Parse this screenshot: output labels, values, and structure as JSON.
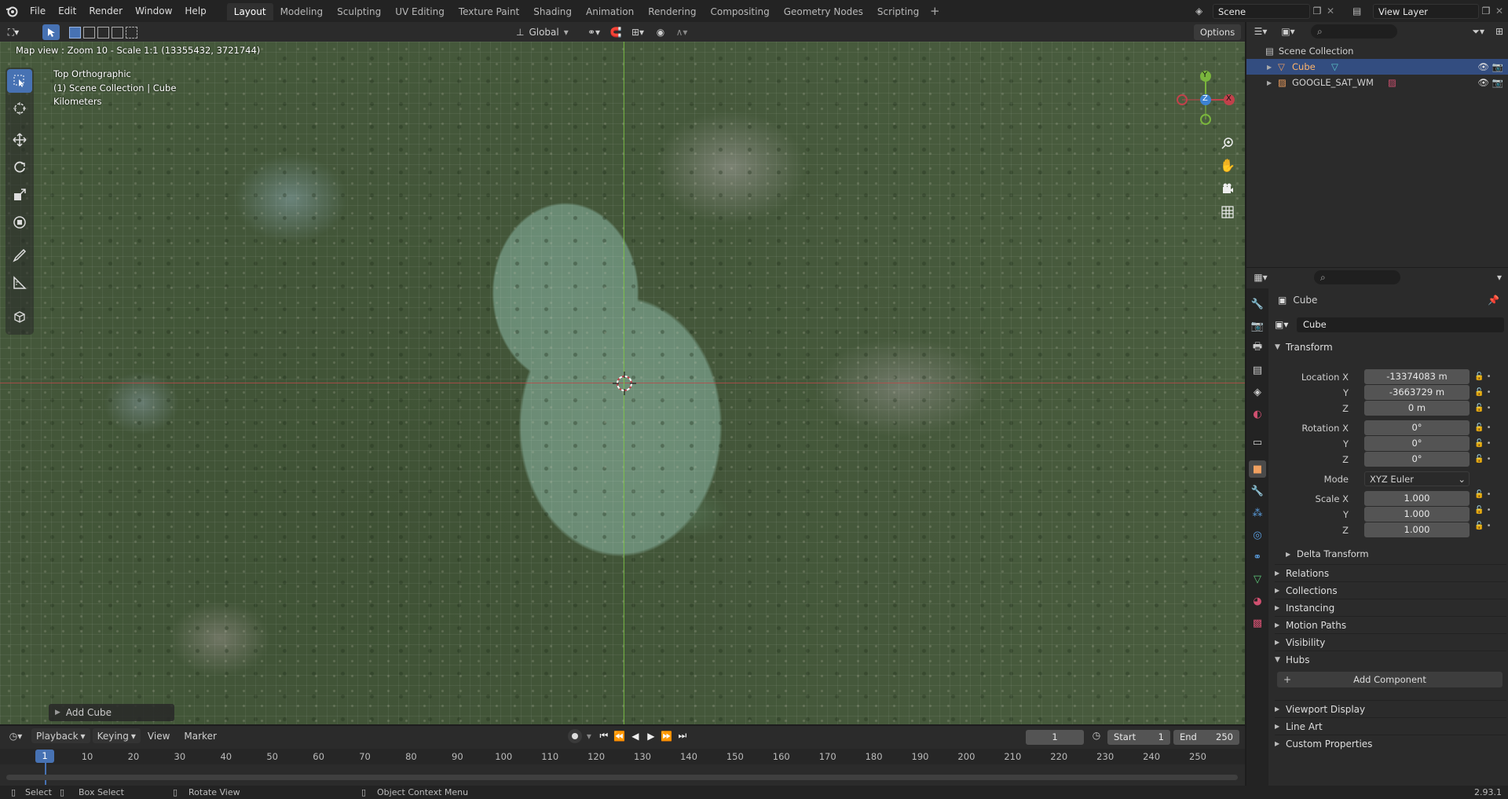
{
  "menu": [
    "File",
    "Edit",
    "Render",
    "Window",
    "Help"
  ],
  "workspaces": [
    "Layout",
    "Modeling",
    "Sculpting",
    "UV Editing",
    "Texture Paint",
    "Shading",
    "Animation",
    "Rendering",
    "Compositing",
    "Geometry Nodes",
    "Scripting"
  ],
  "scene_name": "Scene",
  "view_layer": "View Layer",
  "viewport": {
    "orientation": "Global",
    "options": "Options",
    "map_status": "Map view : Zoom 10 - Scale 1:1 (13355432, 3721744)",
    "overlay_title": "Top Orthographic",
    "overlay_collection": "(1) Scene Collection | Cube",
    "overlay_units": "Kilometers",
    "gizmo": {
      "y": "Y",
      "z": "Z",
      "x": "X"
    },
    "operator_panel": "Add Cube"
  },
  "outliner": {
    "root": "Scene Collection",
    "items": [
      {
        "name": "Cube"
      },
      {
        "name": "GOOGLE_SAT_WM"
      }
    ]
  },
  "properties": {
    "object_name": "Cube",
    "datablock_name": "Cube",
    "transform_label": "Transform",
    "location_x_label": "Location X",
    "location_x": "-13374083 m",
    "y_label": "Y",
    "location_y": "-3663729 m",
    "z_label": "Z",
    "location_z": "0 m",
    "rotation_x_label": "Rotation X",
    "rotation_x": "0°",
    "rotation_y": "0°",
    "rotation_z": "0°",
    "mode_label": "Mode",
    "mode": "XYZ Euler",
    "scale_x_label": "Scale X",
    "scale_x": "1.000",
    "scale_y": "1.000",
    "scale_z": "1.000",
    "delta": "Delta Transform",
    "panels_a": [
      "Relations",
      "Collections",
      "Instancing",
      "Motion Paths",
      "Visibility"
    ],
    "hubs": "Hubs",
    "add_component": "Add Component",
    "panels_b": [
      "Viewport Display",
      "Line Art",
      "Custom Properties"
    ]
  },
  "timeline": {
    "playback": "Playback",
    "keying": "Keying",
    "view": "View",
    "marker": "Marker",
    "current_frame": "1",
    "start_label": "Start",
    "start": "1",
    "end_label": "End",
    "end": "250",
    "ticks": [
      "1",
      "10",
      "20",
      "30",
      "40",
      "50",
      "60",
      "70",
      "80",
      "90",
      "100",
      "110",
      "120",
      "130",
      "140",
      "150",
      "160",
      "170",
      "180",
      "190",
      "200",
      "210",
      "220",
      "230",
      "240",
      "250"
    ]
  },
  "statusbar": {
    "select": "Select",
    "box_select": "Box Select",
    "rotate_view": "Rotate View",
    "context_menu": "Object Context Menu",
    "version": "2.93.1"
  },
  "colors": {
    "accent": "#4772b3",
    "axis_x": "#c1414b",
    "axis_y": "#7ab53d",
    "axis_z": "#3d82d1"
  }
}
